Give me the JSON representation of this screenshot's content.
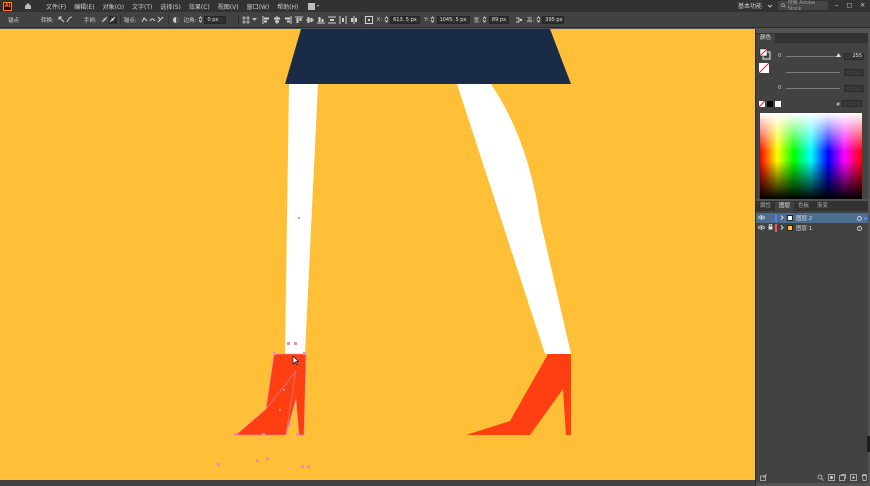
{
  "app": {
    "logo_text": "Ai"
  },
  "menu": {
    "items": [
      "文件(F)",
      "编辑(E)",
      "对象(O)",
      "文字(T)",
      "选择(S)",
      "效果(C)",
      "视图(V)",
      "窗口(W)",
      "帮助(H)"
    ],
    "workspace": "基本功能",
    "search_placeholder": "搜索 Adobe Stock"
  },
  "control": {
    "anchor_label": "锚点",
    "convert_label": "转换:",
    "handles_label": "手柄:",
    "anchor2_label": "锚点:",
    "corner_label": "边角:",
    "corner_value": "0 px",
    "x_label": "X:",
    "x_value": "613. 5 px",
    "y_label": "Y:",
    "y_value": "1045. 5 px",
    "w_label": "宽:",
    "w_value": "89 px",
    "h_label": "高:",
    "h_value": "395 px"
  },
  "color_panel": {
    "tab": "颜色",
    "sliders": [
      {
        "label": "0",
        "value": "255"
      },
      {
        "label": "",
        "value": ""
      },
      {
        "label": "0",
        "value": ""
      }
    ],
    "hex_label": "#"
  },
  "layers_panel": {
    "tabs": [
      "属性",
      "图层",
      "色板",
      "渐变"
    ],
    "active_tab": "图层",
    "layers": [
      {
        "name": "图层 2",
        "color": "#4f7fff",
        "thumb": "#ffffff",
        "selected": true
      },
      {
        "name": "图层 1",
        "color": "#ff4f4f",
        "thumb": "#ffbf37",
        "selected": false
      }
    ]
  },
  "artwork": {
    "background": "#ffbf37",
    "skirt_color": "#1a2b48",
    "leg_color": "#ffffff",
    "shoe_color": "#ff3e12"
  }
}
